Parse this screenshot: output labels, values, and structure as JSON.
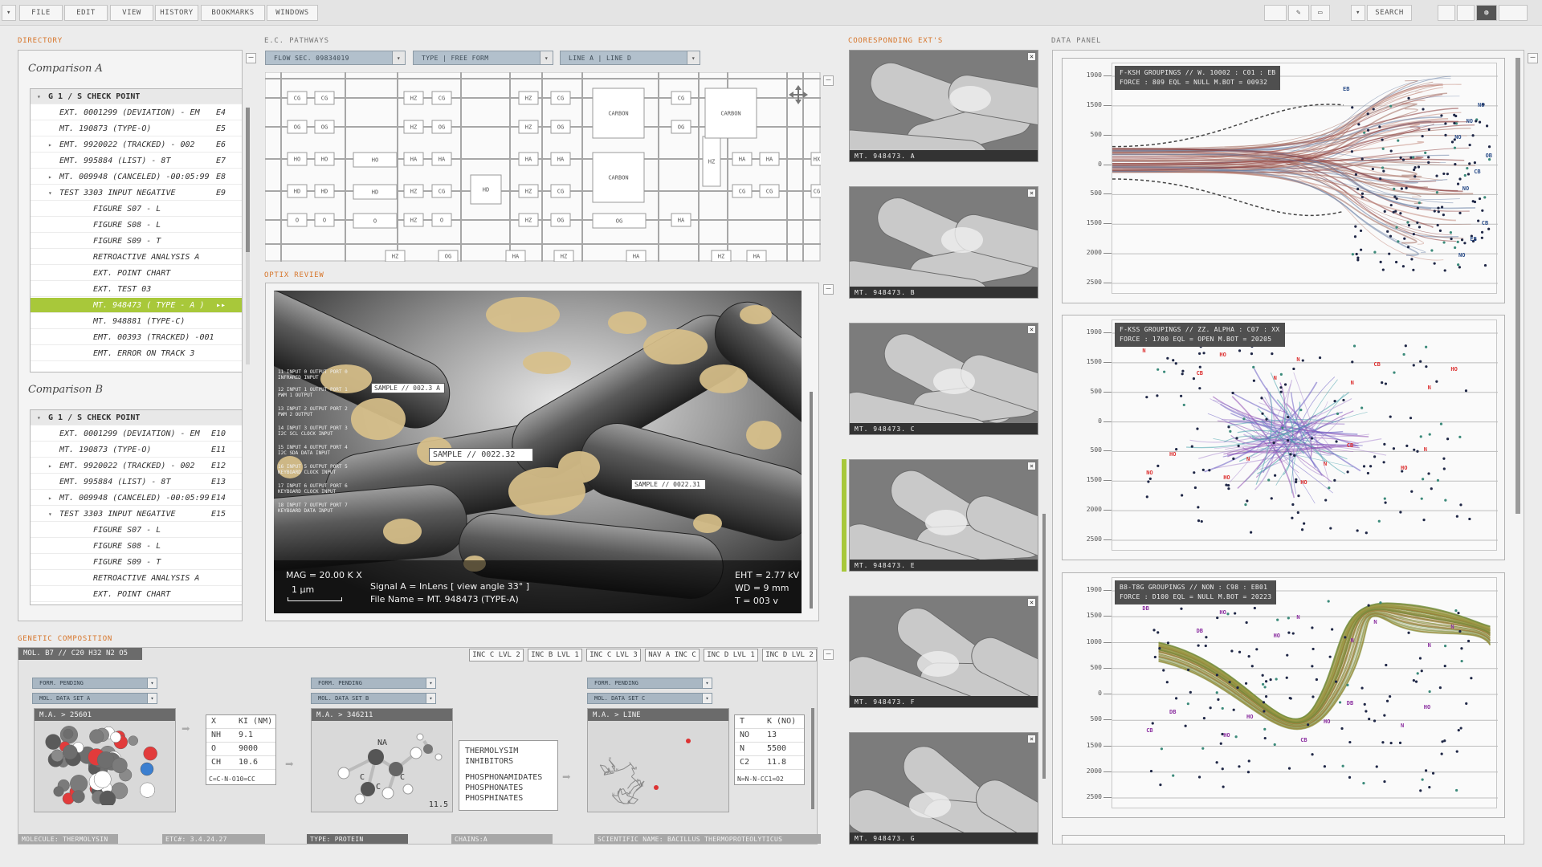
{
  "menu": {
    "items": [
      "FILE",
      "EDIT",
      "VIEW",
      "HISTORY",
      "BOOKMARKS",
      "WINDOWS"
    ],
    "search_label": "SEARCH"
  },
  "sections": {
    "directory": "DIRECTORY",
    "pathways": "E.C. PATHWAYS",
    "optix": "OPTIX REVIEW",
    "exts": "COORESPONDING EXT'S",
    "data_panel": "DATA PANEL",
    "genetic": "GENETIC COMPOSITION"
  },
  "directory": {
    "comparison_a": {
      "title": "Comparison A",
      "head": "G 1 / S CHECK POINT",
      "rows": [
        {
          "label": "EXT. 0001299 (DEVIATION) - EM",
          "code": "E4",
          "indent": 1,
          "tri": ""
        },
        {
          "label": "MT. 190873 (TYPE-O)",
          "code": "E5",
          "indent": 1,
          "tri": ""
        },
        {
          "label": "EMT. 9920022 (TRACKED) - 002",
          "code": "E6",
          "indent": 1,
          "tri": "▸"
        },
        {
          "label": "EMT. 995884 (LIST) - 8T",
          "code": "E7",
          "indent": 1,
          "tri": ""
        },
        {
          "label": "MT. 009948 (CANCELED) -00:05:99",
          "code": "E8",
          "indent": 1,
          "tri": "▸"
        },
        {
          "label": "TEST 3303 INPUT NEGATIVE",
          "code": "E9",
          "indent": 1,
          "tri": "▾"
        },
        {
          "label": "FIGURE S07 - L",
          "code": "",
          "indent": 2,
          "tri": ""
        },
        {
          "label": "FIGURE S08 - L",
          "code": "",
          "indent": 2,
          "tri": ""
        },
        {
          "label": "FIGURE S09 - T",
          "code": "",
          "indent": 2,
          "tri": ""
        },
        {
          "label": "RETROACTIVE ANALYSIS  A",
          "code": "",
          "indent": 2,
          "tri": ""
        },
        {
          "label": "EXT. POINT CHART",
          "code": "",
          "indent": 2,
          "tri": ""
        },
        {
          "label": "EXT. TEST 03",
          "code": "",
          "indent": 2,
          "tri": ""
        },
        {
          "label": "MT. 948473 ( TYPE - A )",
          "code": "▸▸",
          "indent": 2,
          "tri": "",
          "selected": true
        },
        {
          "label": "MT. 948881 (TYPE-C)",
          "code": "",
          "indent": 2,
          "tri": ""
        },
        {
          "label": "EMT. 00393 (TRACKED) -001",
          "code": "",
          "indent": 2,
          "tri": ""
        },
        {
          "label": "EMT. ERROR ON TRACK 3",
          "code": "",
          "indent": 2,
          "tri": ""
        }
      ]
    },
    "comparison_b": {
      "title": "Comparison B",
      "head": "G 1 / S CHECK POINT",
      "rows": [
        {
          "label": "EXT. 0001299 (DEVIATION) - EM",
          "code": "E10",
          "indent": 1,
          "tri": ""
        },
        {
          "label": "MT. 190873 (TYPE-O)",
          "code": "E11",
          "indent": 1,
          "tri": ""
        },
        {
          "label": "EMT. 9920022 (TRACKED) - 002",
          "code": "E12",
          "indent": 1,
          "tri": "▸"
        },
        {
          "label": "EMT. 995884 (LIST) - 8T",
          "code": "E13",
          "indent": 1,
          "tri": ""
        },
        {
          "label": "MT. 009948 (CANCELED) -00:05:99",
          "code": "E14",
          "indent": 1,
          "tri": "▸"
        },
        {
          "label": "TEST 3303 INPUT NEGATIVE",
          "code": "E15",
          "indent": 1,
          "tri": "▾"
        },
        {
          "label": "FIGURE S07 - L",
          "code": "",
          "indent": 2,
          "tri": ""
        },
        {
          "label": "FIGURE S08 - L",
          "code": "",
          "indent": 2,
          "tri": ""
        },
        {
          "label": "FIGURE S09 - T",
          "code": "",
          "indent": 2,
          "tri": ""
        },
        {
          "label": "RETROACTIVE ANALYSIS  A",
          "code": "",
          "indent": 2,
          "tri": ""
        },
        {
          "label": "EXT. POINT CHART",
          "code": "",
          "indent": 2,
          "tri": ""
        }
      ]
    }
  },
  "pathways": {
    "dropdowns": [
      "FLOW SEC. 09834019",
      "TYPE | FREE FORM",
      "LINE A | LINE D"
    ],
    "nodes": [
      "CG",
      "OG",
      "HO",
      "HD",
      "O",
      "HZ",
      "HA",
      "HO",
      "HD",
      "CARBON",
      "CARBON",
      "CARBON",
      "HZ",
      "HA",
      "CG",
      "OG",
      "HA"
    ]
  },
  "optix": {
    "samples": [
      "SAMPLE // 002.3 A",
      "SAMPLE // 0022.32",
      "SAMPLE // 0022.31"
    ],
    "side_notes": [
      "11 INPUT 0 OUTPUT PORT 0 INFRARED INPUT",
      "12 INPUT 1 OUTPUT PORT 1 PWM 1 OUTPUT",
      "13 INPUT 2 OUTPUT PORT 2 PWM 2 OUTPUT",
      "14 INPUT 3 OUTPUT PORT 3 I2C SCL CLOCK INPUT",
      "15 INPUT 4 OUTPUT PORT 4 I2C SDA DATA INPUT",
      "16 INPUT 5 OUTPUT PORT 5 KEYBOARD CLOCK INPUT",
      "17 INPUT 6 OUTPUT PORT 6 KEYBOARD CLOCK INPUT",
      "18 INPUT 7 OUTPUT PORT 7 KEYBOARD DATA INPUT"
    ],
    "mag": "MAG = 20.00 K X",
    "scale": "1 μm",
    "signal": "Signal A = InLens [ view angle 33° ]",
    "file": "File Name = MT. 948473 (TYPE-A)",
    "eht": "EHT = 2.77 kV",
    "wd": "WD = 9 mm",
    "t": "T = 003 v"
  },
  "exts": {
    "thumbs": [
      {
        "cap": "MT. 948473. A",
        "selected": false
      },
      {
        "cap": "MT. 948473. B",
        "selected": false
      },
      {
        "cap": "MT. 948473. C",
        "selected": false
      },
      {
        "cap": "MT. 948473. E",
        "selected": true
      },
      {
        "cap": "MT. 948473. F",
        "selected": false
      },
      {
        "cap": "MT. 948473. G",
        "selected": false
      }
    ]
  },
  "data_panel": {
    "charts": [
      {
        "label_line1": "F-KSH GROUPINGS  //  W. 10002 : C01 : EB",
        "label_line2": "FORCE : 809   EQL = NULL  M.BOT = 00932",
        "yticks": [
          "1900",
          "1500",
          "500",
          "0",
          "500",
          "1500",
          "2000",
          "2500"
        ],
        "markers": [
          "EB",
          "OB",
          "CB",
          "NO",
          "CB",
          "EB",
          "NO",
          "NO",
          "NO",
          "NO"
        ],
        "colors": [
          "#a06a5c",
          "#8b3a3a",
          "#6b82a6",
          "#c38a7d"
        ]
      },
      {
        "label_line1": "F-KSS GROUPINGS  //  ZZ. ALPHA : C07 : XX",
        "label_line2": "FORCE : 1700   EQL = OPEN  M.BOT = 20205",
        "yticks": [
          "1900",
          "1500",
          "500",
          "0",
          "500",
          "1500",
          "2000",
          "2500"
        ],
        "markers": [
          "N",
          "CB",
          "HO",
          "N",
          "N",
          "HO",
          "CB",
          "N",
          "HO",
          "N",
          "CB",
          "HO",
          "N",
          "NO",
          "N",
          "HO",
          "N",
          "HO"
        ],
        "colors": [
          "#6a5cc2",
          "#8f4fb3",
          "#3f9fa8",
          "#ab8bd0"
        ]
      },
      {
        "label_line1": "B8-T8G GROUPINGS  //  NON : C98 : EB01",
        "label_line2": "FORCE : D100   EQL = NULL  M.BOT = 20223",
        "yticks": [
          "1900",
          "1500",
          "1000",
          "500",
          "0",
          "500",
          "1500",
          "2000",
          "2500"
        ],
        "markers": [
          "DB",
          "DB",
          "HO",
          "HO",
          "N",
          "DB",
          "N",
          "HO",
          "N",
          "HO",
          "DB",
          "N",
          "HO",
          "CB",
          "N",
          "HO",
          "N",
          "CB"
        ],
        "colors": [
          "#8c8a3c",
          "#6e8a3c",
          "#a87a3a",
          "#9aa24a"
        ]
      }
    ]
  },
  "genetic": {
    "mol_label": "MOL. B7  //  C20 H32 N2 O5",
    "inc_buttons": [
      "INC C LVL 2",
      "INC B LVL 1",
      "INC C LVL 3",
      "NAV A INC C",
      "INC D LVL 1",
      "INC D LVL 2"
    ],
    "boxes": [
      {
        "form": "FORM. PENDING",
        "set": "MOL. DATA SET A",
        "head": "M.A. > 25601",
        "table_h": [
          "X",
          "KI (NM)"
        ],
        "table_rows": [
          [
            "NH",
            "9.1"
          ],
          [
            "O",
            "9000"
          ],
          [
            "CH",
            "10.6"
          ]
        ],
        "formula": "C=C-N-O10=CC"
      },
      {
        "form": "FORM. PENDING",
        "set": "MOL. DATA SET B",
        "head": "M.A. > 346211",
        "corner": "11.5",
        "atom_na": "NA",
        "atom_c1": "C",
        "atom_c2": "C",
        "atom_c3": "C",
        "inhib_title1": "THERMOLYSIM",
        "inhib_title2": "INHIBITORS",
        "inhib_items": [
          "PHOSPHONAMIDATES",
          "PHOSPHONATES",
          "PHOSPHINATES"
        ]
      },
      {
        "form": "FORM. PENDING",
        "set": "MOL. DATA SET C",
        "head": "M.A. > LINE",
        "table_h": [
          "T",
          "K (NO)"
        ],
        "table_rows": [
          [
            "NO",
            "13"
          ],
          [
            "N",
            "5500"
          ],
          [
            "C2",
            "11.8"
          ]
        ],
        "formula": "N=N-N-CC1=O2"
      }
    ],
    "footer": [
      "MOLECULE: THERMOLYSIN",
      "ETC#: 3.4.24.27",
      "TYPE: PROTEIN",
      "CHAINS:A",
      "SCIENTIFIC NAME: BACILLUS THERMOPROTEOLYTICUS"
    ]
  }
}
